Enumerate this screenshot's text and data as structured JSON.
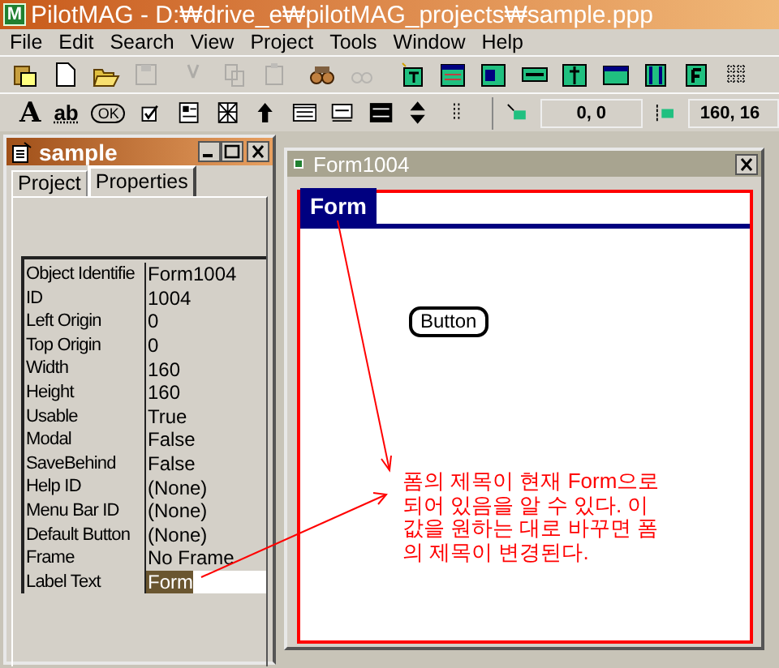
{
  "window": {
    "app_icon": "M",
    "title": "PilotMAG - D:₩drive_e₩pilotMAG_projects₩sample.ppp"
  },
  "menu": [
    "File",
    "Edit",
    "Search",
    "View",
    "Project",
    "Tools",
    "Window",
    "Help"
  ],
  "toolbar_1": [
    {
      "kind": "clipboard",
      "disabled": false
    },
    {
      "kind": "new",
      "disabled": false
    },
    {
      "kind": "open",
      "disabled": false
    },
    {
      "kind": "save",
      "disabled": true
    },
    {
      "kind": "cut",
      "disabled": true
    },
    {
      "kind": "copy",
      "disabled": true
    },
    {
      "kind": "paste",
      "disabled": true
    },
    {
      "kind": "find",
      "disabled": false
    },
    {
      "kind": "findnext",
      "disabled": true
    },
    {
      "kind": "newform",
      "disabled": false
    },
    {
      "kind": "table",
      "disabled": false
    },
    {
      "kind": "list",
      "disabled": false
    },
    {
      "kind": "label",
      "disabled": false
    },
    {
      "kind": "field",
      "disabled": false
    },
    {
      "kind": "window",
      "disabled": false
    },
    {
      "kind": "column",
      "disabled": false
    },
    {
      "kind": "font",
      "disabled": false
    },
    {
      "kind": "grid",
      "disabled": false
    }
  ],
  "toolbar_2": [
    {
      "kind": "label",
      "text": "A"
    },
    {
      "kind": "field",
      "text": "ab"
    },
    {
      "kind": "button",
      "text": "OK"
    },
    {
      "kind": "checkbox"
    },
    {
      "kind": "table"
    },
    {
      "kind": "gadget"
    },
    {
      "kind": "arrow"
    },
    {
      "kind": "list"
    },
    {
      "kind": "popup"
    },
    {
      "kind": "pushbutton"
    },
    {
      "kind": "updown"
    },
    {
      "kind": "dots"
    }
  ],
  "position": "0, 0",
  "size": "160, 16",
  "project_window": {
    "title": "sample",
    "tabs": [
      {
        "label": "Project",
        "selected": false
      },
      {
        "label": "Properties",
        "selected": true
      }
    ],
    "properties": [
      {
        "name": "Object Identifie",
        "value": "Form1004",
        "selected": false
      },
      {
        "name": "ID",
        "value": "1004",
        "selected": false
      },
      {
        "name": "Left Origin",
        "value": "0",
        "selected": false
      },
      {
        "name": "Top Origin",
        "value": "0",
        "selected": false
      },
      {
        "name": "Width",
        "value": "160",
        "selected": false
      },
      {
        "name": "Height",
        "value": "160",
        "selected": false
      },
      {
        "name": "Usable",
        "value": "True",
        "selected": false
      },
      {
        "name": "Modal",
        "value": "False",
        "selected": false
      },
      {
        "name": "SaveBehind",
        "value": "False",
        "selected": false
      },
      {
        "name": "Help ID",
        "value": "(None)",
        "selected": false
      },
      {
        "name": "Menu Bar ID",
        "value": "(None)",
        "selected": false
      },
      {
        "name": "Default Button",
        "value": "(None)",
        "selected": false
      },
      {
        "name": "Frame",
        "value": "No Frame",
        "selected": false
      },
      {
        "name": "Label Text",
        "value": "Form",
        "selected": true
      }
    ]
  },
  "form_window": {
    "title": "Form1004",
    "form_title": "Form",
    "button": "Button",
    "annotation": [
      "폼의 제목이 현재 Form으로",
      "되어 있음을 알 수 있다. 이",
      "값을 원하는 대로 바꾸면 폼",
      "의 제목이 변경된다."
    ]
  }
}
